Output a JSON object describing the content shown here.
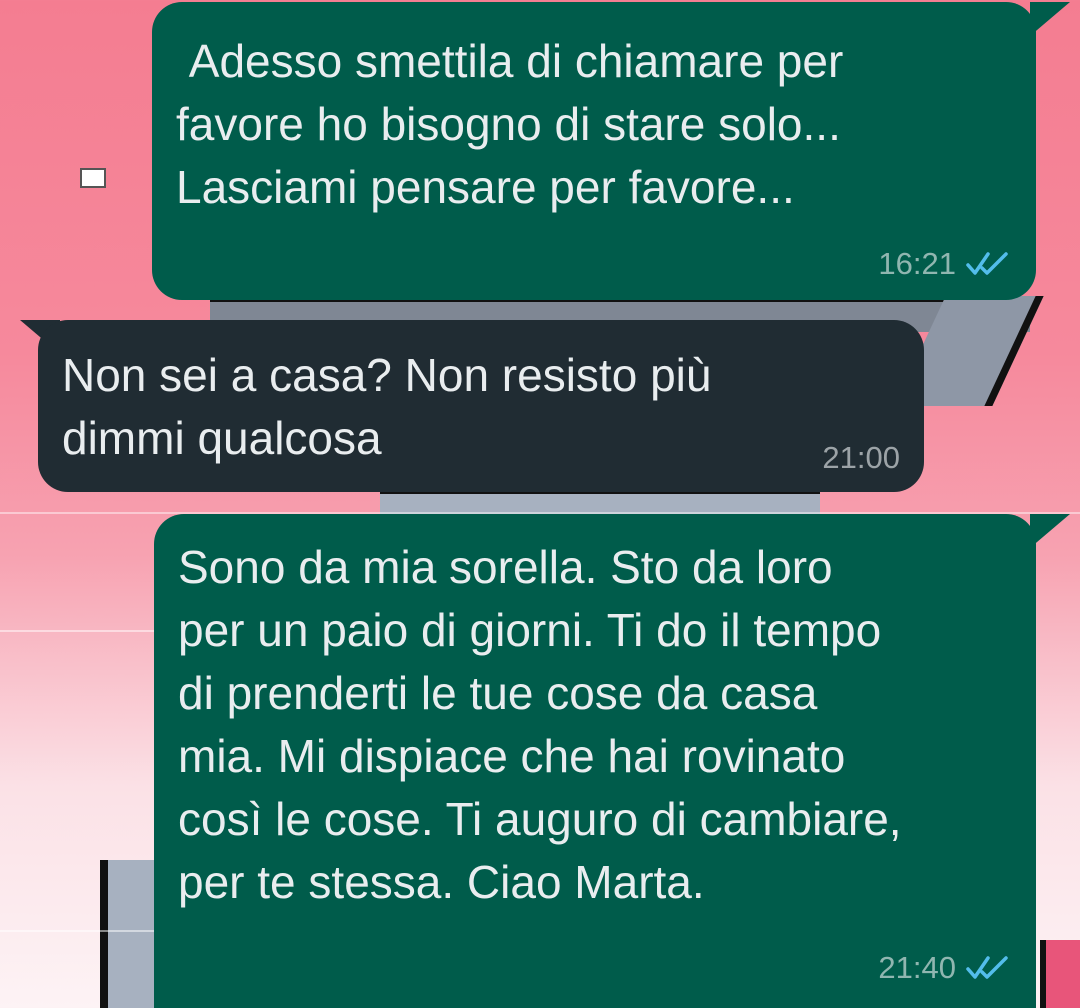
{
  "messages": [
    {
      "direction": "outgoing",
      "text": " Adesso smettila di chiamare per\nfavore ho bisogno di stare solo...\nLasciami pensare per favore...",
      "time": "16:21",
      "status_icon": "double-check-read-icon"
    },
    {
      "direction": "incoming",
      "text": "Non sei a casa? Non resisto più\ndimmi qualcosa",
      "time": "21:00"
    },
    {
      "direction": "outgoing",
      "text": "Sono da mia sorella. Sto da loro\nper un paio di giorni. Ti do il tempo\ndi prenderti le tue cose da casa\nmia. Mi dispiace che hai rovinato\ncosì le cose. Ti auguro di cambiare,\nper te stessa. Ciao Marta.",
      "time": "21:40",
      "status_icon": "double-check-read-icon"
    }
  ],
  "colors": {
    "outgoing_bubble": "#005c4b",
    "incoming_bubble": "#202c33",
    "read_ticks": "#53bdeb",
    "wallpaper_top": "#f47d91"
  }
}
